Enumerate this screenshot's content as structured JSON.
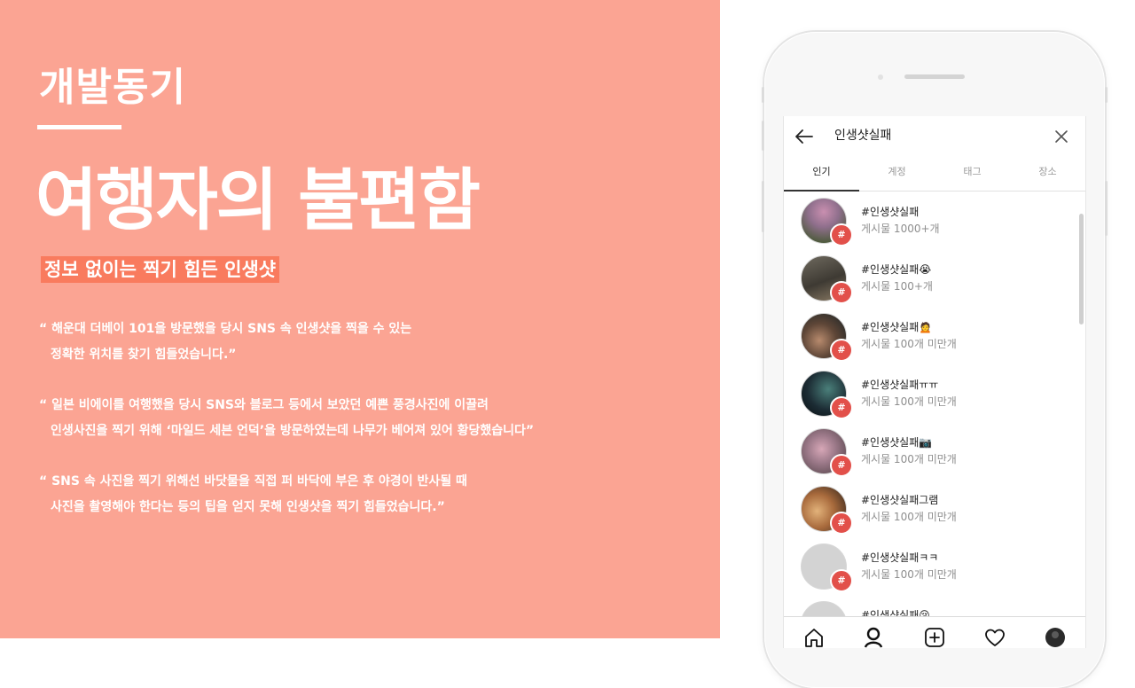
{
  "slide": {
    "section_label": "개발동기",
    "headline": "여행자의 불편함",
    "subheadline": "정보 없이는 찍기 힘든 인생샷",
    "quotes": [
      {
        "line1": "“ 해운대 더베이 101을 방문했을 당시 SNS 속 인생샷을 찍을 수 있는",
        "line2": "정확한 위치를 찾기 힘들었습니다.”"
      },
      {
        "line1": "“ 일본 비에이를 여행했을 당시 SNS와 블로그 등에서 보았던 예쁜 풍경사진에 이끌려",
        "line2": "인생사진을 찍기 위해 ‘마일드 세븐 언덕’을 방문하였는데 나무가 베어져 있어 황당했습니다”"
      },
      {
        "line1": "“ SNS 속 사진을 찍기 위해선 바닷물을 직접 퍼 바닥에 부은 후 야경이 반사될 때",
        "line2": "사진을 촬영해야 한다는 등의 팁을 얻지 못해 인생샷을 찍기 힘들었습니다.”"
      }
    ],
    "colors": {
      "background": "#fba493",
      "subheadline_bg": "#f97b5e",
      "text": "#ffffff"
    }
  },
  "phone": {
    "search_term": "인생샷실패",
    "back_icon": "back-arrow-icon",
    "close_icon": "close-icon",
    "tabs": [
      {
        "label": "인기",
        "active": true
      },
      {
        "label": "계정",
        "active": false
      },
      {
        "label": "태그",
        "active": false
      },
      {
        "label": "장소",
        "active": false
      }
    ],
    "badge_symbol": "#",
    "results": [
      {
        "tag": "#인생샷실패",
        "count": "게시물 1000+개"
      },
      {
        "tag": "#인생샷실패😭",
        "count": "게시물 100+개"
      },
      {
        "tag": "#인생샷실패🙍",
        "count": "게시물 100개 미만개"
      },
      {
        "tag": "#인생샷실패ㅠㅠ",
        "count": "게시물 100개 미만개"
      },
      {
        "tag": "#인생샷실패📷",
        "count": "게시물 100개 미만개"
      },
      {
        "tag": "#인생샷실패그램",
        "count": "게시물 100개 미만개"
      },
      {
        "tag": "#인생샷실패ㅋㅋ",
        "count": "게시물 100개 미만개"
      },
      {
        "tag": "#인생샷실패😢",
        "count": ""
      }
    ],
    "nav_icons": [
      "home-icon",
      "search-icon",
      "add-post-icon",
      "heart-icon",
      "profile-avatar-icon"
    ],
    "colors": {
      "badge": "#e2504a",
      "muted_text": "#8e8e8e"
    }
  }
}
